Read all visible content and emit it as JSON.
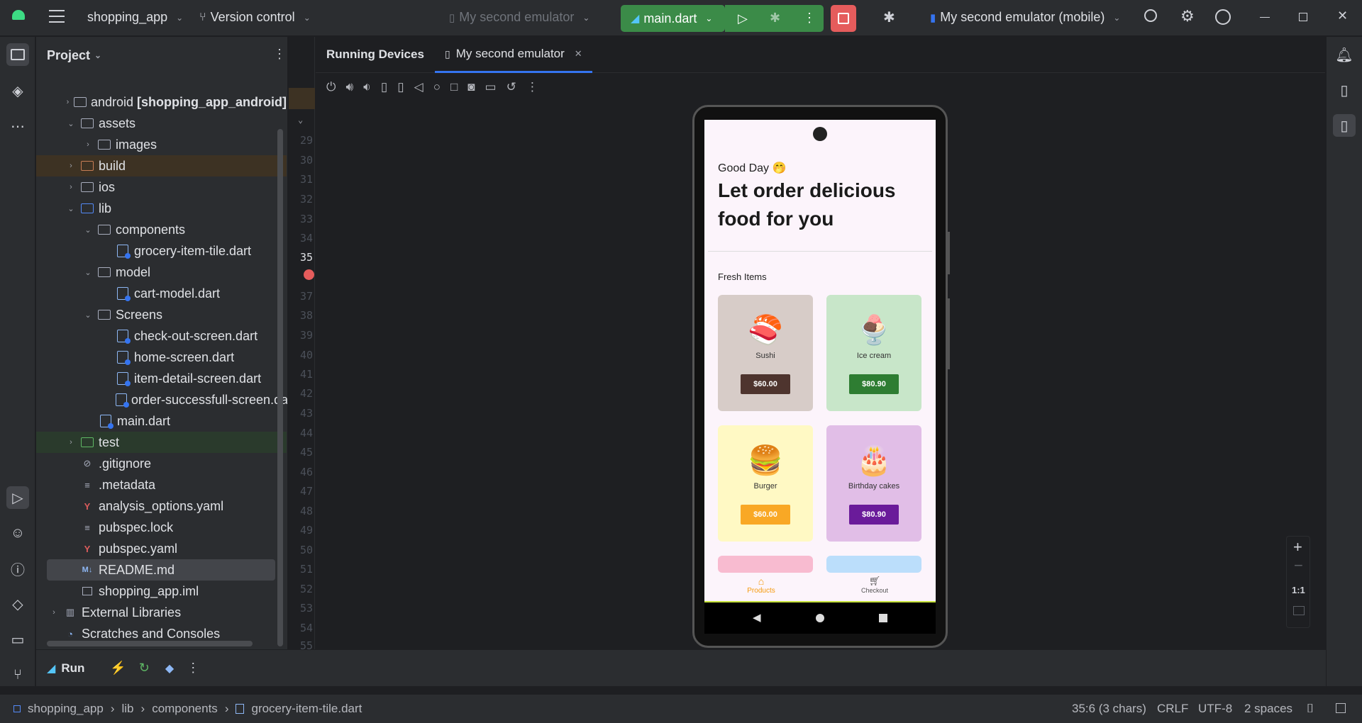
{
  "titlebar": {
    "project": "shopping_app",
    "vcs": "Version control",
    "device_selector": "My second emulator",
    "run_config": "main.dart",
    "target_device": "My second emulator (mobile)"
  },
  "project_panel": {
    "title": "Project",
    "rows": [
      {
        "label": "android",
        "extra": "[shopping_app_android]"
      },
      {
        "label": "assets"
      },
      {
        "label": "images"
      },
      {
        "label": "build"
      },
      {
        "label": "ios"
      },
      {
        "label": "lib"
      },
      {
        "label": "components"
      },
      {
        "label": "grocery-item-tile.dart"
      },
      {
        "label": "model"
      },
      {
        "label": "cart-model.dart"
      },
      {
        "label": "Screens"
      },
      {
        "label": "check-out-screen.dart"
      },
      {
        "label": "home-screen.dart"
      },
      {
        "label": "item-detail-screen.dart"
      },
      {
        "label": "order-successfull-screen.dart"
      },
      {
        "label": "main.dart"
      },
      {
        "label": "test"
      },
      {
        "label": ".gitignore"
      },
      {
        "label": ".metadata"
      },
      {
        "label": "analysis_options.yaml"
      },
      {
        "label": "pubspec.lock"
      },
      {
        "label": "pubspec.yaml"
      },
      {
        "label": "README.md"
      },
      {
        "label": "shopping_app.iml"
      },
      {
        "label": "External Libraries"
      },
      {
        "label": "Scratches and Consoles"
      }
    ]
  },
  "gutter": {
    "lines": [
      "29",
      "30",
      "31",
      "32",
      "33",
      "34",
      "35",
      "",
      "37",
      "38",
      "39",
      "40",
      "41",
      "42",
      "43",
      "44",
      "45",
      "46",
      "47",
      "48",
      "49",
      "50",
      "51",
      "52",
      "53",
      "54",
      "55"
    ]
  },
  "devices": {
    "panel_title": "Running Devices",
    "tab_label": "My second emulator",
    "zoom_ratio": "1:1"
  },
  "app": {
    "greeting": "Good Day 🤭",
    "headline_1": "Let order delicious",
    "headline_2": "food for you",
    "section": "Fresh Items",
    "items": [
      {
        "name": "Sushi",
        "price": "$60.00",
        "emoji": "🍣",
        "bg": "#d7ccc8",
        "btn": "#4e342e"
      },
      {
        "name": "Ice cream",
        "price": "$80.90",
        "emoji": "🍨",
        "bg": "#c8e6c9",
        "btn": "#2e7d32"
      },
      {
        "name": "Burger",
        "price": "$60.00",
        "emoji": "🍔",
        "bg": "#fff9c4",
        "btn": "#f9a825"
      },
      {
        "name": "Birthday cakes",
        "price": "$80.90",
        "emoji": "🎂",
        "bg": "#e1bee7",
        "btn": "#6a1b9a"
      }
    ],
    "nav": {
      "products": "Products",
      "checkout": "Checkout"
    }
  },
  "runbar": {
    "label": "Run"
  },
  "statusbar": {
    "crumbs": [
      "shopping_app",
      "lib",
      "components",
      "grocery-item-tile.dart"
    ],
    "position": "35:6 (3 chars)",
    "line_sep": "CRLF",
    "encoding": "UTF-8",
    "indent": "2 spaces"
  }
}
